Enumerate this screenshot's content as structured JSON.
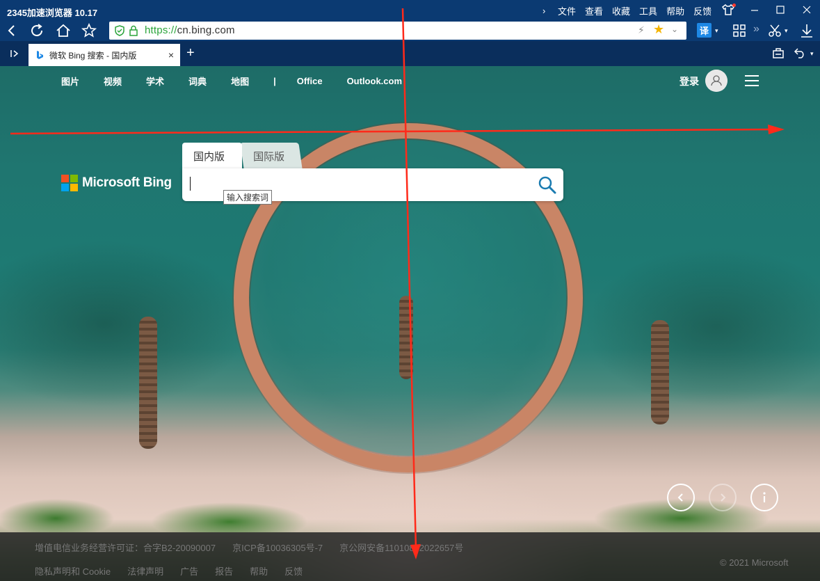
{
  "browser": {
    "app_title": "2345加速浏览器 10.17",
    "menu": [
      "文件",
      "查看",
      "收藏",
      "工具",
      "帮助",
      "反馈"
    ],
    "url_protocol": "https://",
    "url_host": "cn.bing.com",
    "translate_label": "译"
  },
  "tab": {
    "title": "微软 Bing 搜索 - 国内版",
    "close": "×",
    "new_tab": "+"
  },
  "bing": {
    "nav": [
      "图片",
      "视频",
      "学术",
      "词典",
      "地图",
      "|",
      "Office",
      "Outlook.com"
    ],
    "login": "登录",
    "logo_text": "Microsoft Bing",
    "logo_colors": [
      "#f25022",
      "#7fba00",
      "#00a4ef",
      "#ffb900"
    ],
    "search_tabs": [
      "国内版",
      "国际版"
    ],
    "search_placeholder": "",
    "tooltip": "输入搜索词"
  },
  "footer": {
    "row1": [
      "增值电信业务经营许可证：合字B2-20090007",
      "京ICP备10036305号-7",
      "京公网安备11010802022657号"
    ],
    "row2": [
      "隐私声明和 Cookie",
      "法律声明",
      "广告",
      "报告",
      "帮助",
      "反馈"
    ],
    "copyright": "© 2021 Microsoft"
  },
  "colors": {
    "chrome_bg": "#0b3a72",
    "accent_blue": "#1e88e5",
    "annotation_red": "#ff2a1a"
  }
}
